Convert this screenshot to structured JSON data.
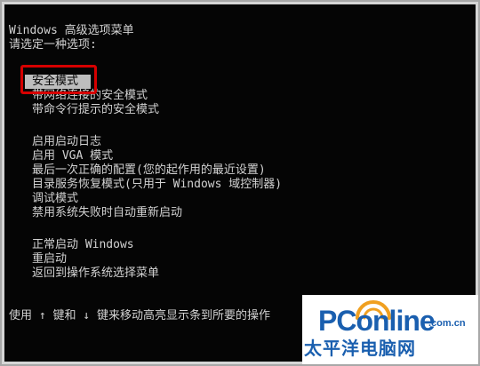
{
  "header": {
    "title": "Windows 高级选项菜单",
    "prompt": "请选定一种选项:"
  },
  "menu": {
    "selected_index": 0,
    "group1": [
      {
        "label": "安全模式"
      },
      {
        "label": "带网络连接的安全模式"
      },
      {
        "label": "带命令行提示的安全模式"
      }
    ],
    "group2": [
      {
        "label": "启用启动日志"
      },
      {
        "label": "启用 VGA 模式"
      },
      {
        "label": "最后一次正确的配置(您的起作用的最近设置)"
      },
      {
        "label": "目录服务恢复模式(只用于 Windows 域控制器)"
      },
      {
        "label": "调试模式"
      },
      {
        "label": "禁用系统失败时自动重新启动"
      }
    ],
    "group3": [
      {
        "label": "正常启动 Windows"
      },
      {
        "label": "重启动"
      },
      {
        "label": "返回到操作系统选择菜单"
      }
    ]
  },
  "footer": {
    "hint": "使用 ↑ 键和 ↓ 键来移动高亮显示条到所要的操作"
  },
  "watermark": {
    "brand": "PConline",
    "domain": ".com.cn",
    "chinese": "太平洋电脑网",
    "brand_color": "#1a5faf",
    "accent_color": "#f0a020"
  },
  "colors": {
    "screen_bg": "#050505",
    "text": "#d2d2d2",
    "selection_bg": "#bdbdbd",
    "annotation_red": "#d60000"
  }
}
